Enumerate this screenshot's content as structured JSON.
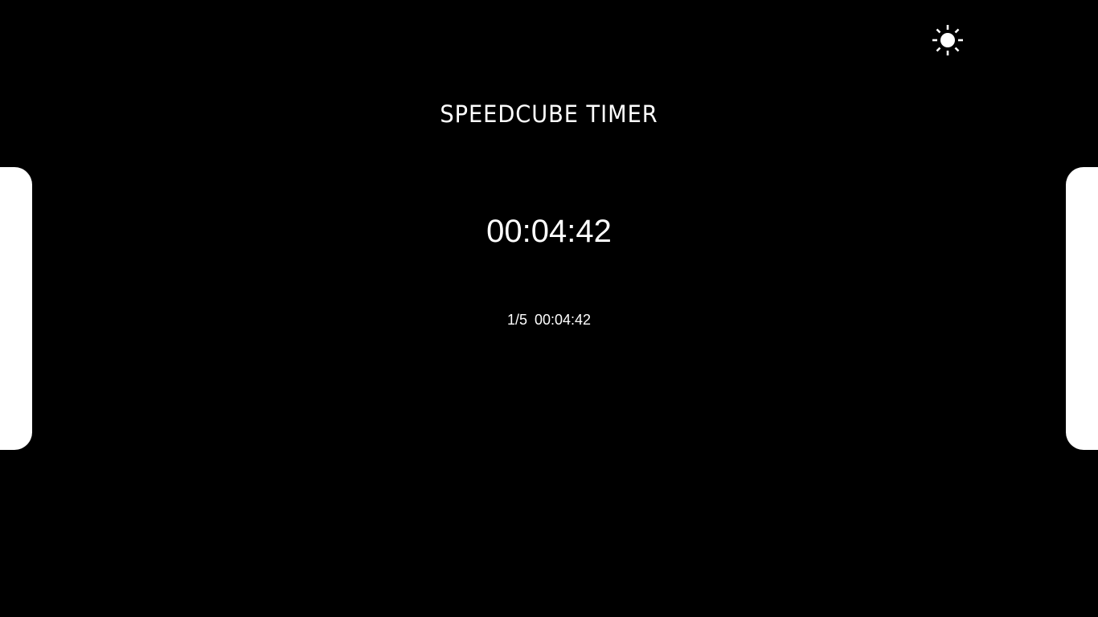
{
  "header": {
    "title": "SPEEDCUBE TIMER",
    "theme_toggle_icon": "sun-icon"
  },
  "timer": {
    "display": "00:04:42"
  },
  "results": [
    {
      "index": "1/5",
      "time": "00:04:42"
    }
  ],
  "colors": {
    "background": "#000000",
    "foreground": "#ffffff",
    "side_panels": "#ffffff"
  }
}
